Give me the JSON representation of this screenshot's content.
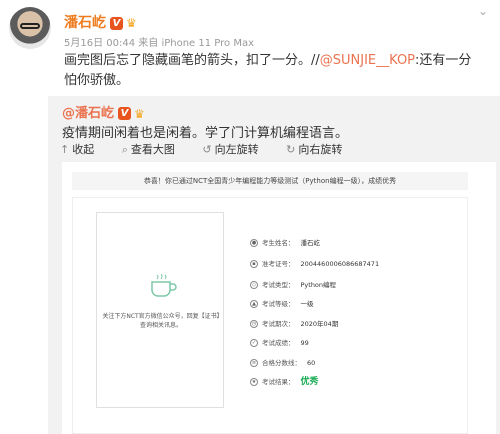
{
  "post": {
    "author": "潘石屹",
    "verified_badge": "V",
    "meta": "5月16日 00:44 来自 iPhone 11 Pro Max",
    "text_before_link": "画完图后忘了隐藏画笔的箭头，扣了一分。//",
    "link": "@SUNJIE__KOP",
    "text_after_link": ":还有一分怕你骄傲。"
  },
  "repost": {
    "author": "@潘石屹",
    "verified_badge": "V",
    "text": "疫情期间闲着也是闲着。学了门计算机编程语言。",
    "actions": [
      "收起",
      "查看大图",
      "向左旋转",
      "向右旋转"
    ]
  },
  "certificate": {
    "banner": "恭喜！你已通过NCT全国青少年编程能力等级测试（Python编程一级），成绩优秀",
    "qr_text": "关注下方NCT官方微信公众号，回复【证书】查询相关讯息。",
    "fields": [
      {
        "label": "考生姓名：",
        "value": "潘石屹"
      },
      {
        "label": "准考证号：",
        "value": "2004460006086687471"
      },
      {
        "label": "考试类型：",
        "value": "Python编程"
      },
      {
        "label": "考试等级：",
        "value": "一级"
      },
      {
        "label": "考试期次：",
        "value": "2020年04期"
      },
      {
        "label": "考试成绩：",
        "value": "99"
      },
      {
        "label": "合格分数线：",
        "value": "60"
      },
      {
        "label": "考试结果：",
        "value": "优秀"
      }
    ]
  },
  "colors": {
    "accent": "#eb7350",
    "author": "#ef7c1f",
    "result": "#1aab55"
  }
}
